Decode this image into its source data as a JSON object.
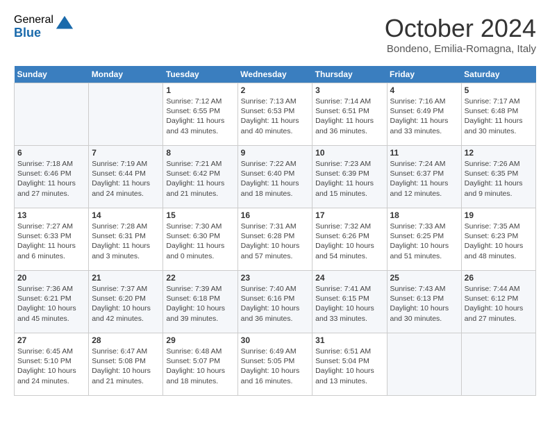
{
  "logo": {
    "general": "General",
    "blue": "Blue"
  },
  "header": {
    "month": "October 2024",
    "location": "Bondeno, Emilia-Romagna, Italy"
  },
  "weekdays": [
    "Sunday",
    "Monday",
    "Tuesday",
    "Wednesday",
    "Thursday",
    "Friday",
    "Saturday"
  ],
  "weeks": [
    [
      {
        "day": "",
        "info": ""
      },
      {
        "day": "",
        "info": ""
      },
      {
        "day": "1",
        "info": "Sunrise: 7:12 AM\nSunset: 6:55 PM\nDaylight: 11 hours and 43 minutes."
      },
      {
        "day": "2",
        "info": "Sunrise: 7:13 AM\nSunset: 6:53 PM\nDaylight: 11 hours and 40 minutes."
      },
      {
        "day": "3",
        "info": "Sunrise: 7:14 AM\nSunset: 6:51 PM\nDaylight: 11 hours and 36 minutes."
      },
      {
        "day": "4",
        "info": "Sunrise: 7:16 AM\nSunset: 6:49 PM\nDaylight: 11 hours and 33 minutes."
      },
      {
        "day": "5",
        "info": "Sunrise: 7:17 AM\nSunset: 6:48 PM\nDaylight: 11 hours and 30 minutes."
      }
    ],
    [
      {
        "day": "6",
        "info": "Sunrise: 7:18 AM\nSunset: 6:46 PM\nDaylight: 11 hours and 27 minutes."
      },
      {
        "day": "7",
        "info": "Sunrise: 7:19 AM\nSunset: 6:44 PM\nDaylight: 11 hours and 24 minutes."
      },
      {
        "day": "8",
        "info": "Sunrise: 7:21 AM\nSunset: 6:42 PM\nDaylight: 11 hours and 21 minutes."
      },
      {
        "day": "9",
        "info": "Sunrise: 7:22 AM\nSunset: 6:40 PM\nDaylight: 11 hours and 18 minutes."
      },
      {
        "day": "10",
        "info": "Sunrise: 7:23 AM\nSunset: 6:39 PM\nDaylight: 11 hours and 15 minutes."
      },
      {
        "day": "11",
        "info": "Sunrise: 7:24 AM\nSunset: 6:37 PM\nDaylight: 11 hours and 12 minutes."
      },
      {
        "day": "12",
        "info": "Sunrise: 7:26 AM\nSunset: 6:35 PM\nDaylight: 11 hours and 9 minutes."
      }
    ],
    [
      {
        "day": "13",
        "info": "Sunrise: 7:27 AM\nSunset: 6:33 PM\nDaylight: 11 hours and 6 minutes."
      },
      {
        "day": "14",
        "info": "Sunrise: 7:28 AM\nSunset: 6:31 PM\nDaylight: 11 hours and 3 minutes."
      },
      {
        "day": "15",
        "info": "Sunrise: 7:30 AM\nSunset: 6:30 PM\nDaylight: 11 hours and 0 minutes."
      },
      {
        "day": "16",
        "info": "Sunrise: 7:31 AM\nSunset: 6:28 PM\nDaylight: 10 hours and 57 minutes."
      },
      {
        "day": "17",
        "info": "Sunrise: 7:32 AM\nSunset: 6:26 PM\nDaylight: 10 hours and 54 minutes."
      },
      {
        "day": "18",
        "info": "Sunrise: 7:33 AM\nSunset: 6:25 PM\nDaylight: 10 hours and 51 minutes."
      },
      {
        "day": "19",
        "info": "Sunrise: 7:35 AM\nSunset: 6:23 PM\nDaylight: 10 hours and 48 minutes."
      }
    ],
    [
      {
        "day": "20",
        "info": "Sunrise: 7:36 AM\nSunset: 6:21 PM\nDaylight: 10 hours and 45 minutes."
      },
      {
        "day": "21",
        "info": "Sunrise: 7:37 AM\nSunset: 6:20 PM\nDaylight: 10 hours and 42 minutes."
      },
      {
        "day": "22",
        "info": "Sunrise: 7:39 AM\nSunset: 6:18 PM\nDaylight: 10 hours and 39 minutes."
      },
      {
        "day": "23",
        "info": "Sunrise: 7:40 AM\nSunset: 6:16 PM\nDaylight: 10 hours and 36 minutes."
      },
      {
        "day": "24",
        "info": "Sunrise: 7:41 AM\nSunset: 6:15 PM\nDaylight: 10 hours and 33 minutes."
      },
      {
        "day": "25",
        "info": "Sunrise: 7:43 AM\nSunset: 6:13 PM\nDaylight: 10 hours and 30 minutes."
      },
      {
        "day": "26",
        "info": "Sunrise: 7:44 AM\nSunset: 6:12 PM\nDaylight: 10 hours and 27 minutes."
      }
    ],
    [
      {
        "day": "27",
        "info": "Sunrise: 6:45 AM\nSunset: 5:10 PM\nDaylight: 10 hours and 24 minutes."
      },
      {
        "day": "28",
        "info": "Sunrise: 6:47 AM\nSunset: 5:08 PM\nDaylight: 10 hours and 21 minutes."
      },
      {
        "day": "29",
        "info": "Sunrise: 6:48 AM\nSunset: 5:07 PM\nDaylight: 10 hours and 18 minutes."
      },
      {
        "day": "30",
        "info": "Sunrise: 6:49 AM\nSunset: 5:05 PM\nDaylight: 10 hours and 16 minutes."
      },
      {
        "day": "31",
        "info": "Sunrise: 6:51 AM\nSunset: 5:04 PM\nDaylight: 10 hours and 13 minutes."
      },
      {
        "day": "",
        "info": ""
      },
      {
        "day": "",
        "info": ""
      }
    ]
  ]
}
